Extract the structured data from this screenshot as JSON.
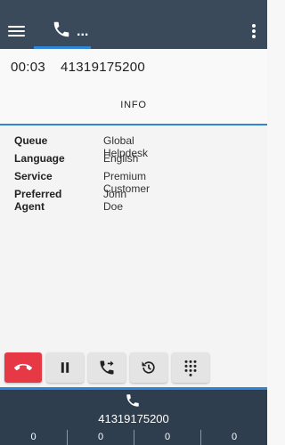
{
  "topbar": {
    "menu_icon": "hamburger-menu-icon",
    "call_tab_icon": "phone-icon",
    "call_tab_more": "...",
    "more_icon": "kebab-menu-icon"
  },
  "call": {
    "timer": "00:03",
    "number": "41319175200",
    "tab_label": "INFO"
  },
  "details": [
    {
      "key": "Queue",
      "value": "Global Helpdesk"
    },
    {
      "key": "Language",
      "value": "English"
    },
    {
      "key": "Service",
      "value": "Premium Customer"
    },
    {
      "key": "Preferred Agent",
      "value": "John Doe"
    }
  ],
  "actions": [
    {
      "name": "hangup-button",
      "icon": "hangup-icon",
      "color": "#e63845"
    },
    {
      "name": "hold-button",
      "icon": "pause-icon"
    },
    {
      "name": "transfer-button",
      "icon": "call-transfer-icon"
    },
    {
      "name": "history-button",
      "icon": "history-icon"
    },
    {
      "name": "dialpad-button",
      "icon": "dialpad-icon"
    }
  ],
  "footer": {
    "icon": "phone-icon",
    "number": "41319175200",
    "counters": [
      "0",
      "0",
      "0",
      "0"
    ]
  },
  "colors": {
    "topbar": "#3b4a5b",
    "accent": "#2f86d9",
    "footer": "#2f3e4e",
    "hangup": "#e63845"
  }
}
